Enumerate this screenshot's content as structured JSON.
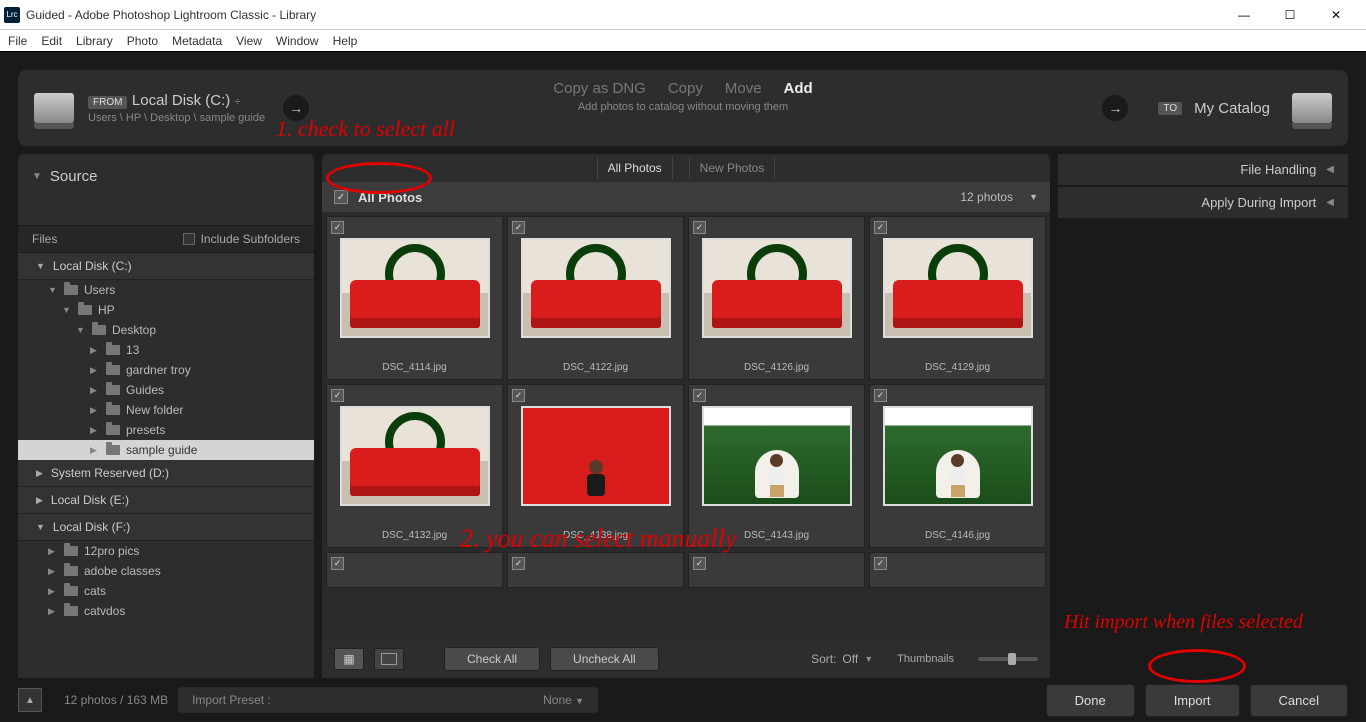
{
  "window": {
    "title": "Guided - Adobe Photoshop Lightroom Classic - Library",
    "app_abbrev": "Lrc"
  },
  "menu": [
    "File",
    "Edit",
    "Library",
    "Photo",
    "Metadata",
    "View",
    "Window",
    "Help"
  ],
  "from": {
    "badge": "FROM",
    "title": "Local Disk (C:) ",
    "path": "Users \\ HP \\ Desktop \\ sample guide"
  },
  "modes": {
    "items": [
      "Copy as DNG",
      "Copy",
      "Move",
      "Add"
    ],
    "active": 3,
    "subtitle": "Add photos to catalog without moving them"
  },
  "to": {
    "badge": "TO",
    "title": "My Catalog"
  },
  "left": {
    "header": "Source",
    "files_label": "Files",
    "include_subfolders": "Include Subfolders",
    "drives": [
      {
        "label": "Local Disk (C:)",
        "expandable": true,
        "expanded": true
      },
      {
        "label": "System Reserved (D:)",
        "expandable": true,
        "expanded": false
      },
      {
        "label": "Local Disk (E:)",
        "expandable": true,
        "expanded": false
      },
      {
        "label": "Local Disk (F:)",
        "expandable": true,
        "expanded": true
      }
    ],
    "tree_c": [
      {
        "label": "Users",
        "indent": 1,
        "exp": true
      },
      {
        "label": "HP",
        "indent": 2,
        "exp": true
      },
      {
        "label": "Desktop",
        "indent": 3,
        "exp": true
      },
      {
        "label": "13",
        "indent": 4
      },
      {
        "label": "gardner troy",
        "indent": 4
      },
      {
        "label": "Guides",
        "indent": 4
      },
      {
        "label": "New folder",
        "indent": 4
      },
      {
        "label": "presets",
        "indent": 4
      },
      {
        "label": "sample guide",
        "indent": 4,
        "selected": true
      }
    ],
    "tree_f": [
      {
        "label": "12pro pics",
        "indent": 1
      },
      {
        "label": "adobe classes",
        "indent": 1
      },
      {
        "label": "cats",
        "indent": 1
      },
      {
        "label": "catvdos",
        "indent": 1
      }
    ]
  },
  "center": {
    "tabs": [
      "All Photos",
      "New Photos"
    ],
    "active_tab": 0,
    "grid_title": "All Photos",
    "count": "12 photos",
    "thumbs": [
      {
        "name": "DSC_4114.jpg",
        "scene": "couch"
      },
      {
        "name": "DSC_4122.jpg",
        "scene": "couch"
      },
      {
        "name": "DSC_4126.jpg",
        "scene": "couch"
      },
      {
        "name": "DSC_4129.jpg",
        "scene": "couch"
      },
      {
        "name": "DSC_4132.jpg",
        "scene": "couch"
      },
      {
        "name": "DSC_4138.jpg",
        "scene": "red"
      },
      {
        "name": "DSC_4143.jpg",
        "scene": "green"
      },
      {
        "name": "DSC_4146.jpg",
        "scene": "green"
      }
    ],
    "check_all": "Check All",
    "uncheck_all": "Uncheck All",
    "sort_label": "Sort:",
    "sort_value": "Off",
    "thumbnails_label": "Thumbnails"
  },
  "right": {
    "rows": [
      "File Handling",
      "Apply During Import"
    ]
  },
  "footer": {
    "info": "12 photos / 163 MB",
    "preset_label": "Import Preset :",
    "preset_value": "None",
    "done": "Done",
    "import": "Import",
    "cancel": "Cancel"
  },
  "annotations": {
    "a1": "1. check to select all",
    "a2": "2. you can select manually",
    "a3": "Hit import when files selected"
  }
}
